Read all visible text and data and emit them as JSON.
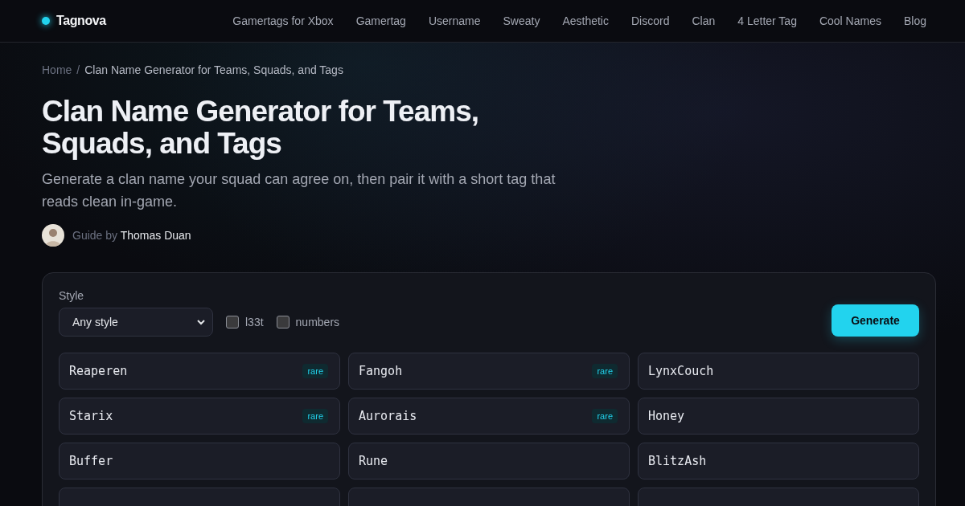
{
  "brand": {
    "name": "Tagnova"
  },
  "nav": [
    {
      "label": "Gamertags for Xbox"
    },
    {
      "label": "Gamertag"
    },
    {
      "label": "Username"
    },
    {
      "label": "Sweaty"
    },
    {
      "label": "Aesthetic"
    },
    {
      "label": "Discord"
    },
    {
      "label": "Clan"
    },
    {
      "label": "4 Letter Tag"
    },
    {
      "label": "Cool Names"
    },
    {
      "label": "Blog"
    }
  ],
  "breadcrumb": {
    "home": "Home",
    "separator": "/",
    "current": "Clan Name Generator for Teams, Squads, and Tags"
  },
  "title": "Clan Name Generator for Teams, Squads, and Tags",
  "subtitle": "Generate a clan name your squad can agree on, then pair it with a short tag that reads clean in-game.",
  "author": {
    "prefix": "Guide by",
    "name": "Thomas Duan"
  },
  "generator": {
    "style_label": "Style",
    "style_value": "Any style",
    "options": [
      {
        "label": "l33t",
        "checked": false
      },
      {
        "label": "numbers",
        "checked": false
      }
    ],
    "button": "Generate",
    "results": [
      {
        "kind": "name",
        "name": "Reaperen",
        "badge": "rare"
      },
      {
        "kind": "name",
        "name": "Fangoh",
        "badge": "rare"
      },
      {
        "kind": "name",
        "name": "LynxCouch"
      },
      {
        "kind": "name",
        "name": "Starix",
        "badge": "rare"
      },
      {
        "kind": "name",
        "name": "Aurorais",
        "badge": "rare"
      },
      {
        "kind": "name",
        "name": "Honey"
      },
      {
        "kind": "name",
        "name": "Buffer"
      },
      {
        "kind": "name",
        "name": "Rune"
      },
      {
        "kind": "name",
        "name": "BlitzAsh"
      },
      {
        "kind": "blank"
      },
      {
        "kind": "blank"
      },
      {
        "kind": "blank"
      }
    ]
  }
}
